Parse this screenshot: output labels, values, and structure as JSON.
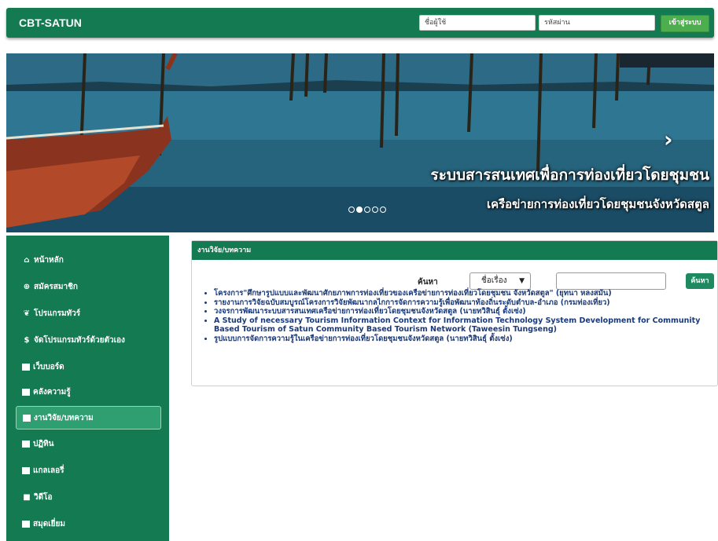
{
  "topbar": {
    "brand": "CBT-SATUN",
    "username_placeholder": "ชื่อผู้ใช้",
    "password_placeholder": "รหัสผ่าน",
    "login_label": "เข้าสู่ระบบ"
  },
  "hero": {
    "line1": "ระบบสารสนเทศเพื่อการท่องเที่ยวโดยชุมชน",
    "line2": "เครือข่ายการท่องเที่ยวโดยชุมชนจังหวัดสตูล",
    "slide_count": 5,
    "active_slide": 2,
    "next_icon": "chevron-right-icon"
  },
  "sidebar": {
    "items": [
      {
        "label": "หน้าหลัก",
        "icon": "home-icon"
      },
      {
        "label": "สมัครสมาชิก",
        "icon": "register-icon"
      },
      {
        "label": "โปรแกรมทัวร์",
        "icon": "leaf-icon"
      },
      {
        "label": "จัดโปรแกรมทัวร์ด้วยตัวเอง",
        "icon": "dollar-icon"
      },
      {
        "label": "เว็บบอร์ด",
        "icon": "board-icon"
      },
      {
        "label": "คลังความรู้",
        "icon": "book-icon"
      },
      {
        "label": "งานวิจัย/บทความ",
        "icon": "document-icon",
        "active": true
      },
      {
        "label": "ปฏิทิน",
        "icon": "calendar-icon"
      },
      {
        "label": "แกลเลอรี่",
        "icon": "gallery-icon"
      },
      {
        "label": "วิดีโอ",
        "icon": "video-icon"
      },
      {
        "label": "สมุดเยี่ยม",
        "icon": "guestbook-icon"
      }
    ]
  },
  "panel": {
    "title": "งานวิจัย/บทความ",
    "search_label": "ค้นหา",
    "search_select_value": "ชื่อเรื่อง",
    "search_input_value": "",
    "search_button": "ค้นหา",
    "results": [
      "โครงการ\"ศึกษารูปแบบและพัฒนาศักยภาพการท่องเที่ยวของเครือข่ายการท่องเที่ยวโดยชุมชน จังหวัดสตูล\" (ยุทนา หลงสมัน)",
      "รายงานการวิจัยฉบับสมบูรณ์โครงการวิจัยพัฒนากลไกการจัดการความรู้เพื่อพัฒนาท้องถิ่นระดับตำบล-อำเภอ (กรมท่องเที่ยว)",
      "วงจรการพัฒนาระบบสารสนเทศเครือข่ายการท่องเที่ยวโดยชุมชนจังหวัดสตูล (นายทวิสินธุ์ ตั้งเซ่ง)",
      "A Study of necessary Tourism Information Context for Information Technology System Development for Community Based Tourism of Satun Community Based Tourism Network (Taweesin Tungseng)",
      "รูปแบบการจัดการความรู้ในเครือข่ายการท่องเที่ยวโดยชุมชนจังหวัดสตูล (นายทวิสินธุ์ ตั้งเซ่ง)"
    ]
  }
}
